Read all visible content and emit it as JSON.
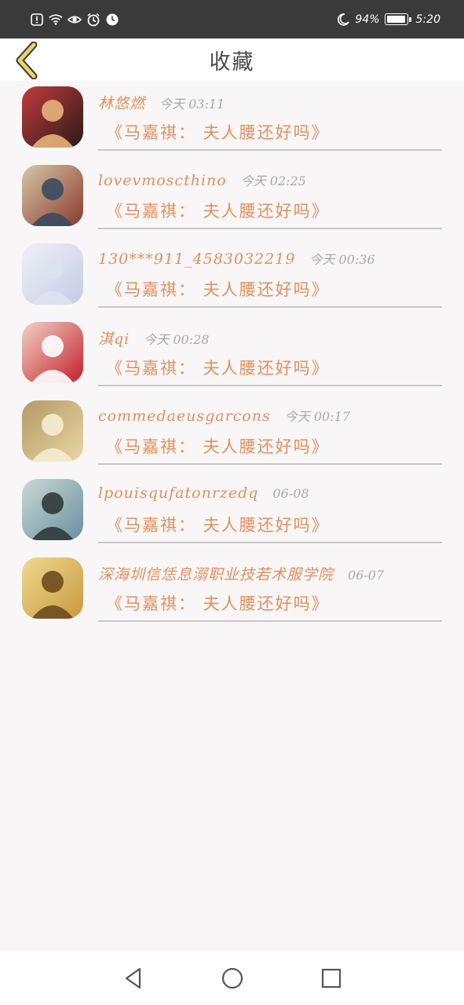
{
  "status_bar": {
    "icons": [
      "alert-icon",
      "wifi-icon",
      "eye-icon",
      "alarm-icon",
      "clock-icon",
      "moon-icon"
    ],
    "battery_text": "94%",
    "battery_level": 0.94,
    "time": "5:20"
  },
  "header": {
    "back_icon": "chevron-left-icon",
    "title": "收藏",
    "accent_color": "#e8d36a"
  },
  "items": [
    {
      "username": "林悠燃",
      "time": "今天 03:11",
      "title": "《马嘉祺： 夫人腰还好吗》",
      "avatar_colors": [
        "#2a1a1a",
        "#c23b3b",
        "#e6b27a"
      ]
    },
    {
      "username": "lovevmoscthino",
      "time": "今天 02:25",
      "title": "《马嘉祺： 夫人腰还好吗》",
      "avatar_colors": [
        "#8a3a2e",
        "#d6c6a8",
        "#3b4a5e"
      ]
    },
    {
      "username": "130***911_4583032219",
      "time": "今天 00:36",
      "title": "《马嘉祺： 夫人腰还好吗》",
      "avatar_colors": [
        "#c5cde3",
        "#eef0f7",
        "#dde2f0"
      ]
    },
    {
      "username": "淇qi",
      "time": "今天 00:28",
      "title": "《马嘉祺： 夫人腰还好吗》",
      "avatar_colors": [
        "#c21e2a",
        "#f3d3c6",
        "#ffffff"
      ]
    },
    {
      "username": "commedaeusgarcons",
      "time": "今天 00:17",
      "title": "《马嘉祺： 夫人腰还好吗》",
      "avatar_colors": [
        "#e8d6a4",
        "#b49a66",
        "#f5ecd0"
      ]
    },
    {
      "username": "lpouisqufatonrzedq",
      "time": "06-08",
      "title": "《马嘉祺： 夫人腰还好吗》",
      "avatar_colors": [
        "#6a8fa0",
        "#c9d9d5",
        "#2d3b3a"
      ]
    },
    {
      "username": "深海圳信恁息溺职业技若术服学院",
      "time": "06-07",
      "title": "《马嘉祺： 夫人腰还好吗》",
      "avatar_colors": [
        "#c89a3e",
        "#f0d890",
        "#6e4c1e"
      ]
    }
  ],
  "nav_bar": {
    "icons": [
      "back-triangle-icon",
      "home-circle-icon",
      "recents-square-icon"
    ]
  },
  "colors": {
    "accent": "#e0905e",
    "muted": "#a8a8a8",
    "divider": "#c9c6c6",
    "background": "#f8f6f7"
  }
}
